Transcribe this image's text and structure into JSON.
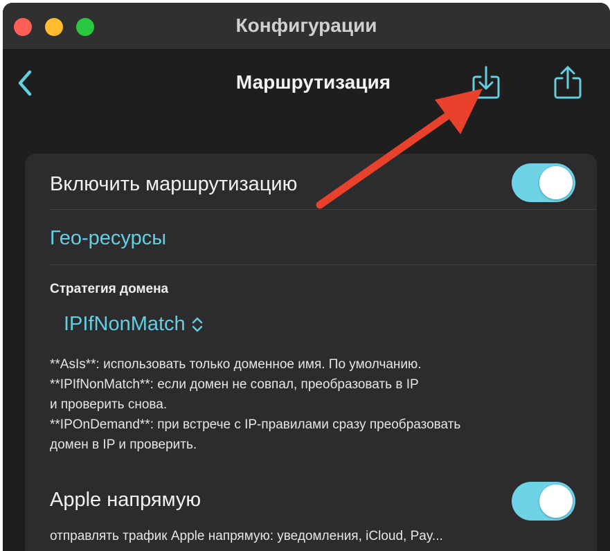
{
  "window": {
    "title": "Конфигурации"
  },
  "navbar": {
    "title": "Маршрутизация",
    "back_icon": "chevron-left-icon",
    "import_icon": "download-tray-icon",
    "share_icon": "share-icon"
  },
  "routing": {
    "enable_label": "Включить маршрутизацию",
    "enable_on": true,
    "geo_link": "Гео-ресурсы",
    "domain_strategy_label": "Стратегия домена",
    "domain_strategy_value": "IPIfNonMatch",
    "description_lines": [
      "**AsIs**: использовать только доменное имя. По умолчанию.",
      "**IPIfNonMatch**: если домен не совпал, преобразовать в IP",
      "и проверить снова.",
      "**IPOnDemand**: при встрече с IP-правилами сразу преобразовать",
      "домен в IP и проверить."
    ],
    "apple_direct_label": "Apple напрямую",
    "apple_direct_on": true,
    "apple_direct_desc": "отправлять трафик Apple напрямую: уведомления, iCloud, Pay..."
  },
  "colors": {
    "accent": "#64cfe0",
    "toggle_on": "#6ed3e6",
    "annotation_arrow": "#e8412c"
  }
}
